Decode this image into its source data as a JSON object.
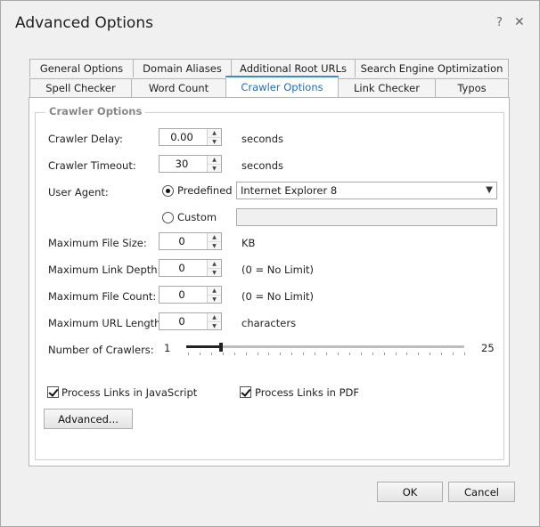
{
  "window": {
    "title": "Advanced Options",
    "help_glyph": "?",
    "close_glyph": "✕"
  },
  "tabs_row1": [
    "General Options",
    "Domain Aliases",
    "Additional Root URLs",
    "Search Engine Optimization"
  ],
  "tabs_row2": [
    "Spell Checker",
    "Word Count",
    "Crawler Options",
    "Link Checker",
    "Typos"
  ],
  "active_tab": "Crawler Options",
  "group": {
    "title": "Crawler Options"
  },
  "fields": {
    "crawler_delay": {
      "label": "Crawler Delay:",
      "value": "0.00",
      "unit": "seconds"
    },
    "crawler_timeout": {
      "label": "Crawler Timeout:",
      "value": "30",
      "unit": "seconds"
    },
    "max_file_size": {
      "label": "Maximum File Size:",
      "value": "0",
      "unit": "KB"
    },
    "max_link_depth": {
      "label": "Maximum Link Depth:",
      "value": "0",
      "unit": "(0 = No Limit)"
    },
    "max_file_count": {
      "label": "Maximum File Count:",
      "value": "0",
      "unit": "(0 = No Limit)"
    },
    "max_url_length": {
      "label": "Maximum URL Length:",
      "value": "0",
      "unit": "characters"
    }
  },
  "user_agent": {
    "label": "User Agent:",
    "predefined_label": "Predefined",
    "custom_label": "Custom",
    "selected": "predefined",
    "predefined_value": "Internet Explorer 8",
    "custom_value": ""
  },
  "crawlers": {
    "label": "Number of Crawlers:",
    "min": "1",
    "max": "25",
    "value": 4,
    "tick_count": 25
  },
  "checkboxes": {
    "js": {
      "label": "Process Links in JavaScript",
      "checked": true
    },
    "pdf": {
      "label": "Process Links in PDF",
      "checked": true
    }
  },
  "buttons": {
    "advanced": "Advanced...",
    "ok": "OK",
    "cancel": "Cancel"
  }
}
